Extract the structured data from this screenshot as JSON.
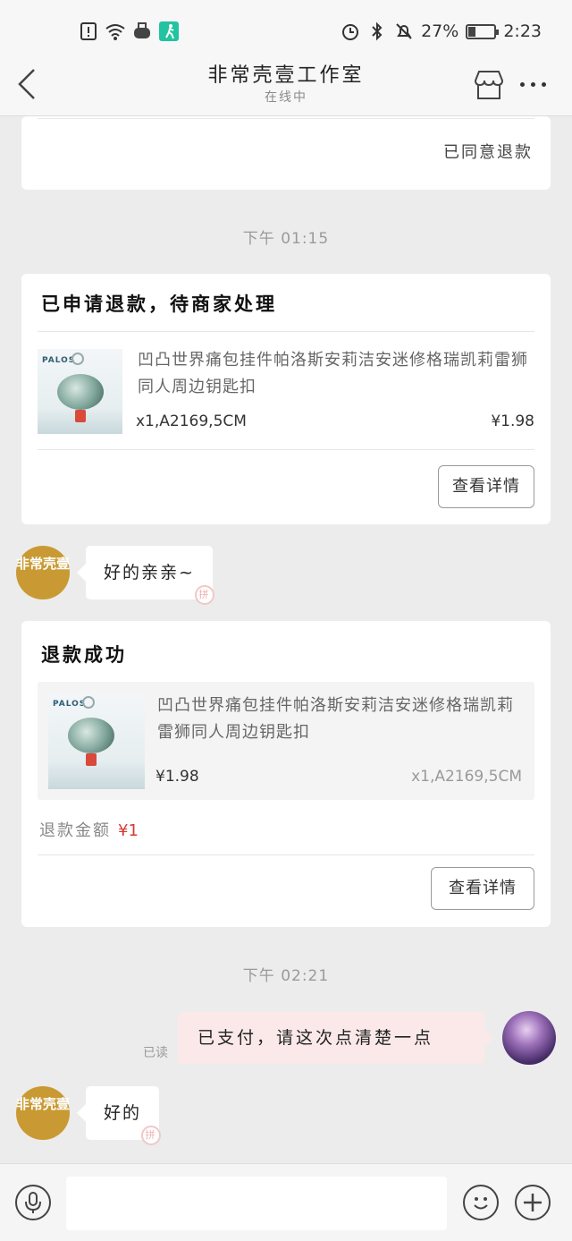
{
  "status_bar": {
    "battery": "27%",
    "battery_level": 0.27,
    "time": "2:23"
  },
  "header": {
    "title": "非常壳壹工作室",
    "subtitle": "在线中"
  },
  "messages": {
    "agreed_refund": "已同意退款",
    "timestamp_1": "下午 01:15",
    "refund_apply": {
      "title": "已申请退款，待商家处理",
      "product_name": "凹凸世界痛包挂件帕洛斯安莉洁安迷修格瑞凯莉雷狮同人周边钥匙扣",
      "sku": "x1,A2169,5CM",
      "price": "¥1.98",
      "detail_button": "查看详情"
    },
    "shop_avatar_text": "非常壳壹",
    "shop_reply_1": "好的亲亲~",
    "refund_success": {
      "title": "退款成功",
      "product_name": "凹凸世界痛包挂件帕洛斯安莉洁安迷修格瑞凯莉雷狮同人周边钥匙扣",
      "price": "¥1.98",
      "sku": "x1,A2169,5CM",
      "refund_label": "退款金额",
      "refund_amount": "¥1",
      "detail_button": "查看详情"
    },
    "timestamp_2": "下午 02:21",
    "read_status": "已读",
    "user_message": "已支付，请这次点清楚一点",
    "shop_reply_2": "好的"
  },
  "product_image": {
    "brand_text": "PALOS"
  },
  "bubble_mark": "拼",
  "input_bar": {
    "placeholder": ""
  },
  "colors": {
    "shop_avatar": "#c99a33",
    "refund_amount": "#d23b32",
    "user_bubble": "#fbe9e9",
    "background": "#ececec"
  }
}
